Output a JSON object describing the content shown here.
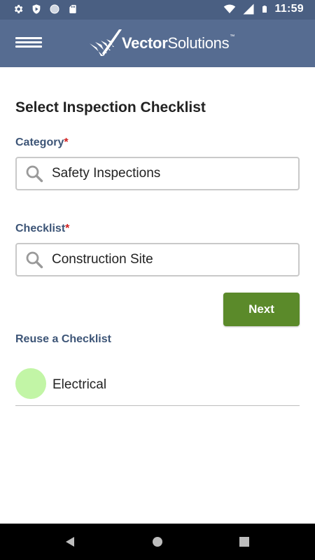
{
  "status_bar": {
    "time": "11:59",
    "left_icons": [
      "gear-icon",
      "play-shield-icon",
      "circle-icon",
      "sd-card-icon"
    ],
    "right_icons": [
      "wifi-icon",
      "signal-icon",
      "battery-icon"
    ]
  },
  "app_bar": {
    "menu_icon": "hamburger-icon",
    "logo_bold": "Vector",
    "logo_light": "Solutions",
    "logo_tm": "™"
  },
  "form": {
    "title": "Select Inspection Checklist",
    "category": {
      "label": "Category",
      "required_mark": "*",
      "value": "Safety Inspections",
      "icon": "search-icon"
    },
    "checklist": {
      "label": "Checklist",
      "required_mark": "*",
      "value": "Construction Site",
      "icon": "search-icon"
    },
    "next_label": "Next"
  },
  "reuse": {
    "label": "Reuse a Checklist",
    "items": [
      {
        "label": "Electrical",
        "avatar_color": "#c2f5a6"
      }
    ]
  },
  "colors": {
    "status_bar": "#4a5f82",
    "app_bar": "#566c91",
    "label_text": "#3d5577",
    "required": "#d11e1e",
    "next_button": "#5b8a2a",
    "nav_bar": "#000000"
  },
  "nav_bar": {
    "buttons": [
      "back-icon",
      "home-icon",
      "recent-apps-icon"
    ]
  }
}
